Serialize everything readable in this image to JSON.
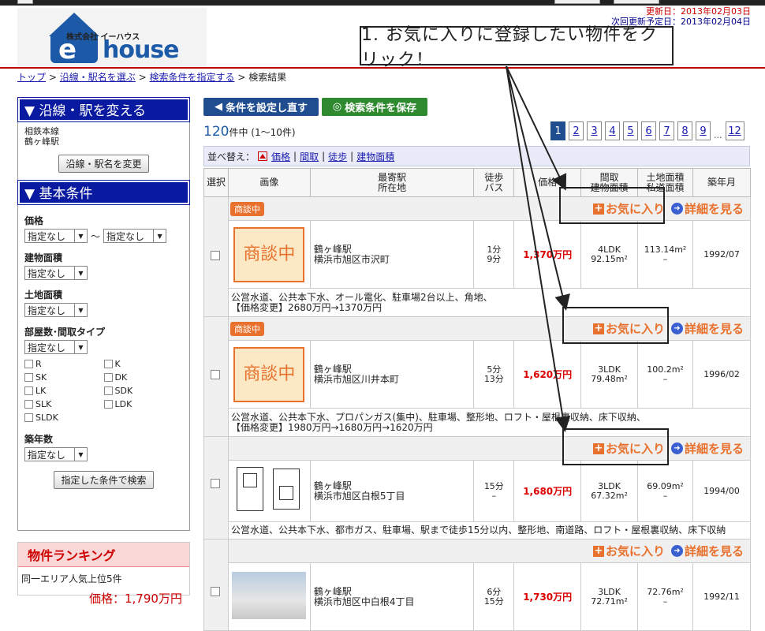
{
  "header": {
    "company_name": "株式会社 イーハウス",
    "brand_e": "e",
    "brand_text": "house",
    "updated": "更新日：2013年02月03日",
    "next_update": "次回更新予定日：2013年02月04日"
  },
  "callout": "1. お気に入りに登録したい物件をクリック！",
  "breadcrumb": {
    "top": "トップ",
    "line": "沿線・駅名を選ぶ",
    "cond": "検索条件を指定する",
    "current": "検索結果",
    "sep": ">"
  },
  "sidebar": {
    "station_head": "▼ 沿線・駅を変える",
    "line_name": "相鉄本線",
    "station_name": "鶴ヶ峰駅",
    "change_btn": "沿線・駅名を変更",
    "basic_head": "▼ 基本条件",
    "price_label": "価格",
    "price_min": "指定なし",
    "price_tilde": "〜",
    "price_max": "指定なし",
    "bldg_label": "建物面積",
    "bldg_val": "指定なし",
    "land_label": "土地面積",
    "land_val": "指定なし",
    "room_label": "部屋数･間取タイプ",
    "room_val": "指定なし",
    "room_types": [
      "R",
      "K",
      "SK",
      "DK",
      "LK",
      "SDK",
      "SLK",
      "LDK",
      "SLDK"
    ],
    "age_label": "築年数",
    "age_val": "指定なし",
    "search_btn": "指定した条件で検索"
  },
  "ranking": {
    "head": "物件ランキング",
    "sub": "同一エリア人気上位5件",
    "price": "価格：1,790万円"
  },
  "main": {
    "reset_btn": "条件を設定し直す",
    "save_btn": "検索条件を保存",
    "count_num": "120",
    "count_text": "件中 (1〜10件)",
    "pages": [
      "1",
      "2",
      "3",
      "4",
      "5",
      "6",
      "7",
      "8",
      "9",
      "12"
    ],
    "dots": "...",
    "sort_label": "並べ替え：",
    "sort_price": "価格",
    "sort_layout": "間取",
    "sort_walk": "徒歩",
    "sort_building": "建物面積",
    "sort_sep": "|"
  },
  "table": {
    "h_select": "選択",
    "h_image": "画像",
    "h_station": "最寄駅",
    "h_address": "所在地",
    "h_walk": "徒歩",
    "h_bus": "バス",
    "h_price": "価格",
    "h_layout": "間取",
    "h_bldg": "建物面積",
    "h_land": "土地面積",
    "h_private": "私道面積",
    "h_built": "築年月",
    "fav": "お気に入り",
    "detail": "詳細を見る",
    "negotiating": "商談中",
    "rows": [
      {
        "status": "商談中",
        "station": "鶴ヶ峰駅",
        "address": "横浜市旭区市沢町",
        "walk": "1分",
        "bus": "9分",
        "price": "1,370万円",
        "layout": "4LDK",
        "bldg": "92.15m²",
        "land": "113.14m²",
        "private": "–",
        "built": "1992/07",
        "features": "公営水道、公共本下水、オール電化、駐車場2台以上、角地、",
        "change": "【価格変更】2680万円→1370万円"
      },
      {
        "status": "商談中",
        "station": "鶴ヶ峰駅",
        "address": "横浜市旭区川井本町",
        "walk": "5分",
        "bus": "13分",
        "price": "1,620万円",
        "layout": "3LDK",
        "bldg": "79.48m²",
        "land": "100.2m²",
        "private": "–",
        "built": "1996/02",
        "features": "公営水道、公共本下水、プロパンガス(集中)、駐車場、整形地、ロフト・屋根裏収納、床下収納、",
        "change": "【価格変更】1980万円→1680万円→1620万円"
      },
      {
        "status": "",
        "station": "鶴ヶ峰駅",
        "address": "横浜市旭区白根5丁目",
        "walk": "15分",
        "bus": "–",
        "price": "1,680万円",
        "layout": "3LDK",
        "bldg": "67.32m²",
        "land": "69.09m²",
        "private": "–",
        "built": "1994/00",
        "features": "公営水道、公共本下水、都市ガス、駐車場、駅まで徒歩15分以内、整形地、南道路、ロフト・屋根裏収納、床下収納",
        "change": ""
      },
      {
        "status": "",
        "station": "鶴ヶ峰駅",
        "address": "横浜市旭区中白根4丁目",
        "walk": "6分",
        "bus": "15分",
        "price": "1,730万円",
        "layout": "3LDK",
        "bldg": "72.71m²",
        "land": "72.76m²",
        "private": "–",
        "built": "1992/11",
        "features": "",
        "change": ""
      }
    ]
  }
}
